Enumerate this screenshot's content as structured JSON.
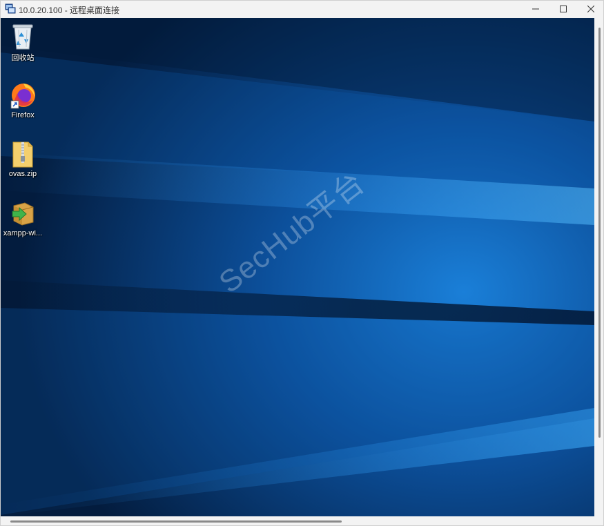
{
  "window": {
    "title": "10.0.20.100 - 远程桌面连接"
  },
  "controls": {
    "minimize_icon": "minimize-icon",
    "maximize_icon": "maximize-icon",
    "close_icon": "close-icon"
  },
  "desktop": {
    "icons": [
      {
        "label": "回收站",
        "icon": "recycle-bin-icon"
      },
      {
        "label": "Firefox",
        "icon": "firefox-icon"
      },
      {
        "label": "ovas.zip",
        "icon": "zip-folder-icon"
      },
      {
        "label": "xampp-wi...",
        "icon": "installer-icon"
      }
    ],
    "watermark": "SecHub平台"
  },
  "colors": {
    "wallpaper_dark": "#021a3a",
    "wallpaper_mid": "#0a4d96",
    "wallpaper_light": "#1e8ee8"
  }
}
